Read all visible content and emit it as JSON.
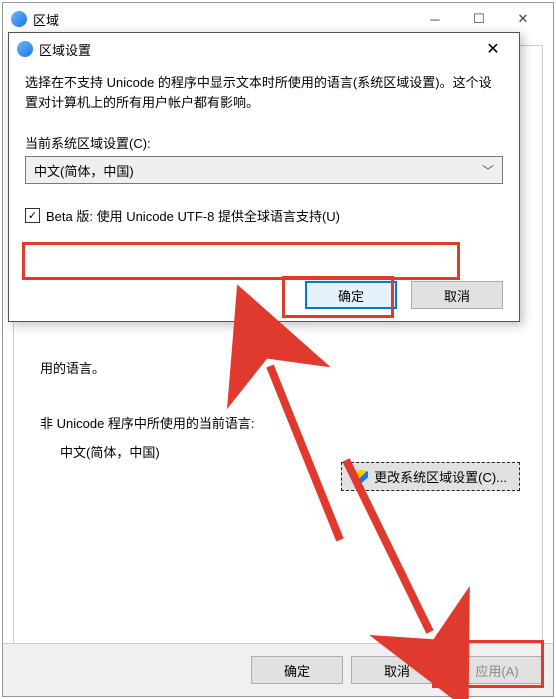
{
  "parent": {
    "title": "区域",
    "line_language_of": "用的语言。",
    "non_unicode_heading": "非 Unicode 程序中所使用的当前语言:",
    "non_unicode_value": "中文(简体，中国)",
    "change_btn": "更改系统区域设置(C)...",
    "ok": "确定",
    "cancel": "取消",
    "apply": "应用(A)"
  },
  "inner": {
    "title": "区域设置",
    "desc": "选择在不支持 Unicode 的程序中显示文本时所使用的语言(系统区域设置)。这个设置对计算机上的所有用户帐户都有影响。",
    "current_label": "当前系统区域设置(C):",
    "current_value": "中文(简体，中国)",
    "beta_checkbox": "Beta 版: 使用 Unicode UTF-8 提供全球语言支持(U)",
    "beta_checked": "✓",
    "ok": "确定",
    "cancel": "取消"
  }
}
